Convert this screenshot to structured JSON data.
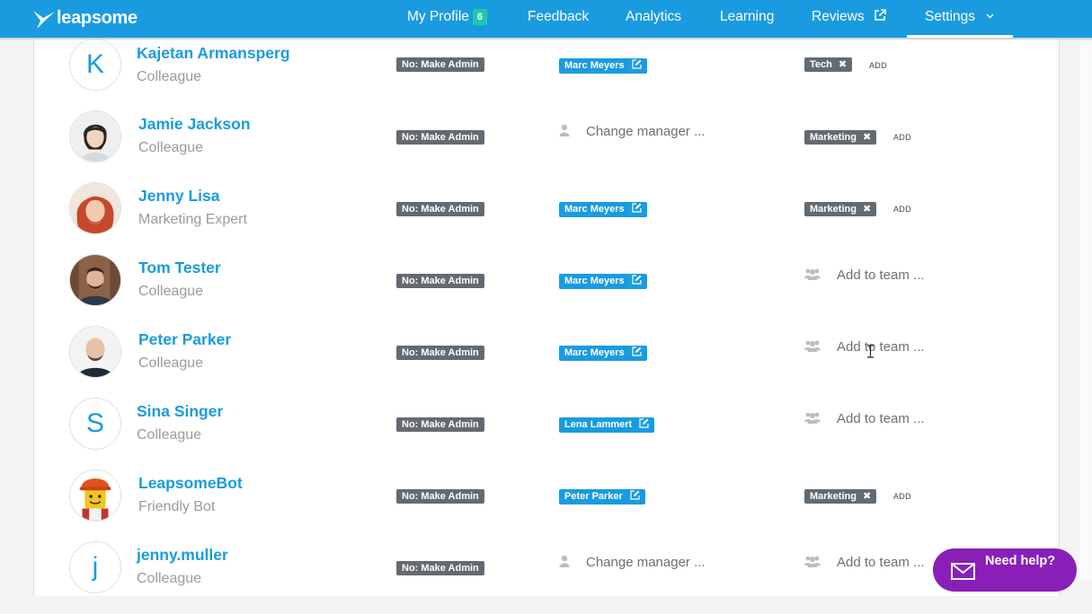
{
  "brand": {
    "name": "leapsome"
  },
  "nav": {
    "items": [
      {
        "label": "My Profile",
        "badge": "6"
      },
      {
        "label": "Feedback"
      },
      {
        "label": "Analytics"
      },
      {
        "label": "Learning"
      },
      {
        "label": "Reviews"
      },
      {
        "label": "Settings"
      }
    ]
  },
  "users": [
    {
      "name": "Kajetan Armansperg",
      "role": "Colleague",
      "avatar": "letter",
      "initial": "K",
      "admin": "No: Make Admin",
      "manager": "Marc Meyers",
      "team": "Tech"
    },
    {
      "name": "Jamie Jackson",
      "role": "Colleague",
      "avatar": "photo",
      "admin": "No: Make Admin",
      "manager": "",
      "team": "Marketing"
    },
    {
      "name": "Jenny Lisa",
      "role": "Marketing Expert",
      "avatar": "photo",
      "admin": "No: Make Admin",
      "manager": "Marc Meyers",
      "team": "Marketing"
    },
    {
      "name": "Tom Tester",
      "role": "Colleague",
      "avatar": "photo",
      "admin": "No: Make Admin",
      "manager": "Marc Meyers",
      "team": ""
    },
    {
      "name": "Peter Parker",
      "role": "Colleague",
      "avatar": "photo",
      "admin": "No: Make Admin",
      "manager": "Marc Meyers",
      "team": ""
    },
    {
      "name": "Sina Singer",
      "role": "Colleague",
      "avatar": "letter",
      "initial": "S",
      "admin": "No: Make Admin",
      "manager": "Lena Lammert",
      "team": ""
    },
    {
      "name": "LeapsomeBot",
      "role": "Friendly Bot",
      "avatar": "photo",
      "admin": "No: Make Admin",
      "manager": "Peter Parker",
      "team": "Marketing"
    },
    {
      "name": "jenny.muller",
      "role": "Colleague",
      "avatar": "letter",
      "initial": "j",
      "admin": "No: Make Admin",
      "manager": "",
      "team": ""
    }
  ],
  "labels": {
    "change_manager": "Change manager ...",
    "add_to_team": "Add to team ...",
    "add": "ADD",
    "remove_icon": "✖"
  },
  "help": {
    "label": "Need help?"
  },
  "colors": {
    "brand": "#1a9be0",
    "tag_gray": "#636b72",
    "help": "#8a1fb8",
    "badge": "#1ec9a8"
  }
}
